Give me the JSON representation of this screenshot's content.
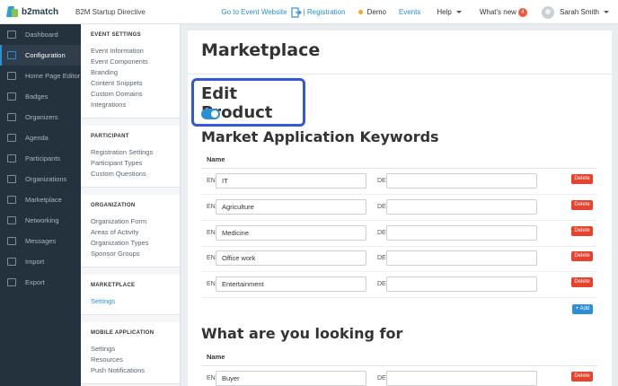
{
  "header": {
    "logo_text": "b2match",
    "event_title": "B2M Startup Directive",
    "goto_website": "Go to Event Website",
    "registration": "| Registration",
    "demo": "Demo",
    "events": "Events",
    "help": "Help",
    "whats_new": "What's new",
    "whats_new_count": "4",
    "user_name": "Sarah Smith"
  },
  "sidebar": {
    "items": [
      {
        "label": "Dashboard",
        "icon": "dashboard-icon"
      },
      {
        "label": "Configuration",
        "icon": "configuration-icon"
      },
      {
        "label": "Home Page Editor",
        "icon": "home-page-editor-icon"
      },
      {
        "label": "Badges",
        "icon": "badges-icon"
      },
      {
        "label": "Organizers",
        "icon": "organizers-icon"
      },
      {
        "label": "Agenda",
        "icon": "agenda-icon"
      },
      {
        "label": "Participants",
        "icon": "participants-icon"
      },
      {
        "label": "Organizations",
        "icon": "organizations-icon"
      },
      {
        "label": "Marketplace",
        "icon": "marketplace-icon"
      },
      {
        "label": "Networking",
        "icon": "networking-icon"
      },
      {
        "label": "Messages",
        "icon": "messages-icon"
      },
      {
        "label": "Import",
        "icon": "import-icon"
      },
      {
        "label": "Export",
        "icon": "export-icon"
      }
    ],
    "active_index": 1
  },
  "subnav": {
    "groups": [
      {
        "title": "EVENT SETTINGS",
        "items": [
          "Event Information",
          "Event Components",
          "Branding",
          "Content Snippets",
          "Custom Domains",
          "Integrations"
        ]
      },
      {
        "title": "PARTICIPANT",
        "items": [
          "Registration Settings",
          "Participant Types",
          "Custom Questions"
        ]
      },
      {
        "title": "ORGANIZATION",
        "items": [
          "Organization Form",
          "Areas of Activity",
          "Organization Types",
          "Sponsor Groups"
        ]
      },
      {
        "title": "MARKETPLACE",
        "items": [
          "Settings"
        ]
      },
      {
        "title": "MOBILE APPLICATION",
        "items": [
          "Settings",
          "Resources",
          "Push Notifications"
        ]
      }
    ],
    "active": "MARKETPLACE.Settings"
  },
  "main": {
    "title": "Marketplace",
    "edit_product": {
      "label": "Edit Product",
      "enabled": true
    },
    "keywords": {
      "title": "Market Application Keywords",
      "col_name": "Name",
      "en_label": "EN",
      "de_label": "DE",
      "delete_label": "Delete",
      "rows": [
        {
          "en": "IT",
          "de": ""
        },
        {
          "en": "Agriculture",
          "de": ""
        },
        {
          "en": "Medicine",
          "de": ""
        },
        {
          "en": "Office work",
          "de": ""
        },
        {
          "en": "Entertainment",
          "de": ""
        }
      ],
      "add_label": "+ Add"
    },
    "looking_for": {
      "title": "What are you looking for",
      "col_name": "Name",
      "en_label": "EN",
      "de_label": "DE",
      "delete_label": "Delete",
      "rows": [
        {
          "en": "Buyer",
          "de": ""
        }
      ]
    }
  },
  "colors": {
    "accent": "#2b8fd6",
    "sidebar_bg": "#24323d",
    "delete": "#e8412c",
    "highlight_border": "#3559d6"
  }
}
